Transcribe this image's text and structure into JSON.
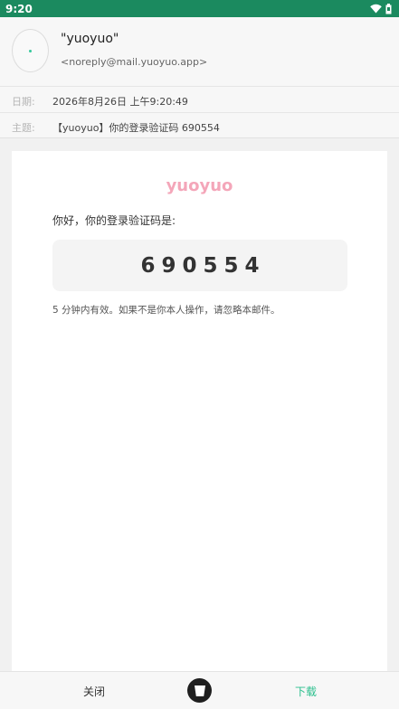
{
  "status_bar": {
    "time": "9:20",
    "icons": [
      "wifi-icon",
      "battery-icon"
    ],
    "bg_color": "#1b8a5f"
  },
  "sender": {
    "name": "\"yuoyuo\"",
    "email": "<noreply@mail.yuoyuo.app>"
  },
  "meta": {
    "date_label": "日期:",
    "date_value": "2026年8月26日 上午9:20:49",
    "subject_label": "主题:",
    "subject_value": "【yuoyuo】你的登录验证码 690554"
  },
  "email_body": {
    "brand": "yuoyuo",
    "brand_color": "#f4a6b9",
    "greeting": "你好，你的登录验证码是:",
    "code": "690554",
    "note": "5 分钟内有效。如果不是你本人操作，请忽略本邮件。"
  },
  "bottom_bar": {
    "close_label": "关闭",
    "delete_icon": "trash-icon",
    "download_label": "下载",
    "download_color": "#2bbf8d"
  }
}
